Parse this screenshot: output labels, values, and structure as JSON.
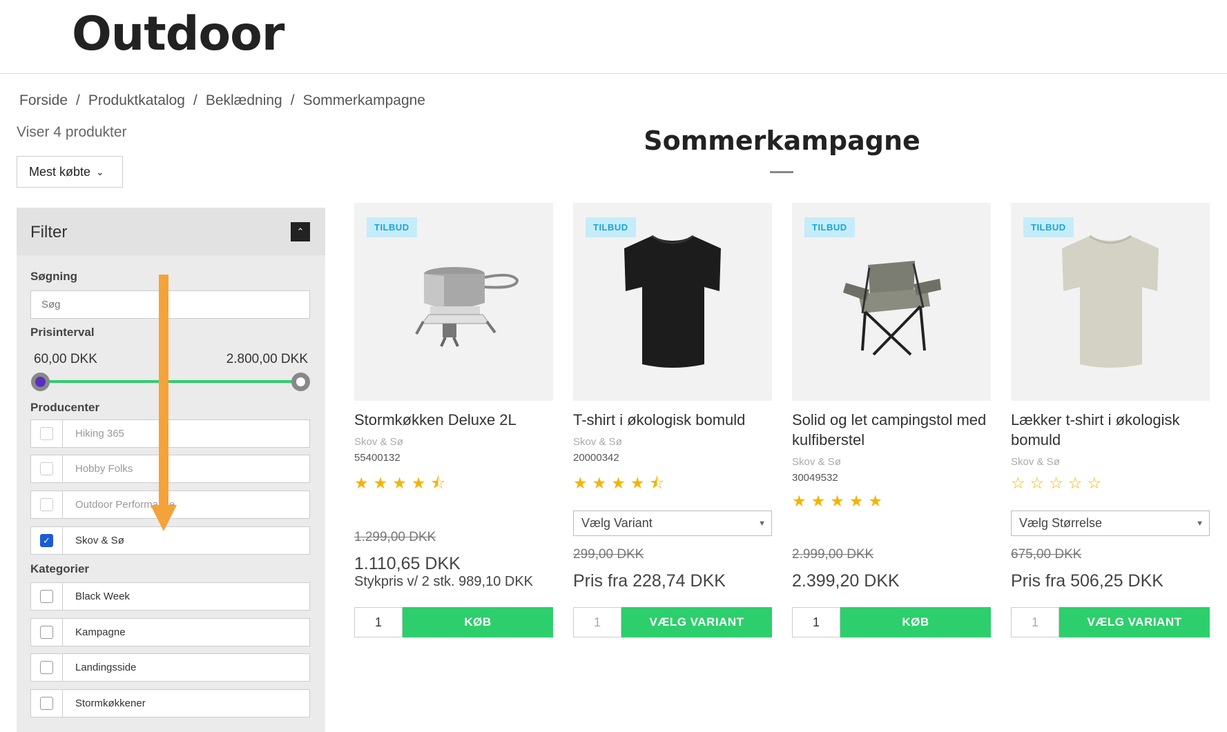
{
  "header": {
    "logo": "Outdoor"
  },
  "breadcrumb": [
    "Forside",
    "Produktkatalog",
    "Beklædning",
    "Sommerkampagne"
  ],
  "listing": {
    "count_text": "Viser 4 produkter",
    "sort_label": "Mest købte",
    "title": "Sommerkampagne"
  },
  "filter": {
    "title": "Filter",
    "search_label": "Søgning",
    "search_placeholder": "Søg",
    "price_label": "Prisinterval",
    "price_min": "60,00 DKK",
    "price_max": "2.800,00 DKK",
    "producers_label": "Producenter",
    "producers": [
      {
        "label": "Hiking 365",
        "checked": false
      },
      {
        "label": "Hobby Folks",
        "checked": false
      },
      {
        "label": "Outdoor Performance",
        "checked": false
      },
      {
        "label": "Skov & Sø",
        "checked": true
      }
    ],
    "categories_label": "Kategorier",
    "categories": [
      {
        "label": "Black Week",
        "checked": false
      },
      {
        "label": "Kampagne",
        "checked": false
      },
      {
        "label": "Landingsside",
        "checked": false
      },
      {
        "label": "Stormkøkkener",
        "checked": false
      }
    ]
  },
  "products": [
    {
      "badge": "TILBUD",
      "name": "Stormkøkken Deluxe 2L",
      "brand": "Skov & Sø",
      "sku": "55400132",
      "rating": 4.5,
      "old_price": "1.299,00 DKK",
      "price": "1.110,65 DKK",
      "unit_price": "Stykpris v/ 2 stk. 989,10 DKK",
      "qty": "1",
      "button": "KØB"
    },
    {
      "badge": "TILBUD",
      "name": "T-shirt i økologisk bomuld",
      "brand": "Skov & Sø",
      "sku": "20000342",
      "rating": 4.5,
      "variant": "Vælg Variant",
      "old_price": "299,00 DKK",
      "price": "Pris fra 228,74 DKK",
      "qty": "1",
      "button": "VÆLG VARIANT"
    },
    {
      "badge": "TILBUD",
      "name": "Solid og let campingstol med kulfiberstel",
      "brand": "Skov & Sø",
      "sku": "30049532",
      "rating": 5,
      "old_price": "2.999,00 DKK",
      "price": "2.399,20 DKK",
      "qty": "1",
      "button": "KØB"
    },
    {
      "badge": "TILBUD",
      "name": "Lækker t-shirt i økologisk bomuld",
      "brand": "Skov & Sø",
      "rating": 0,
      "variant": "Vælg Størrelse",
      "old_price": "675,00 DKK",
      "price": "Pris fra 506,25 DKK",
      "qty": "1",
      "button": "VÆLG VARIANT"
    }
  ],
  "colors": {
    "accent_green": "#2dcf6c",
    "badge_bg": "#c6ecf9",
    "badge_text": "#17a6d8",
    "star": "#f3b500",
    "annotation_arrow": "#f5a23a"
  }
}
